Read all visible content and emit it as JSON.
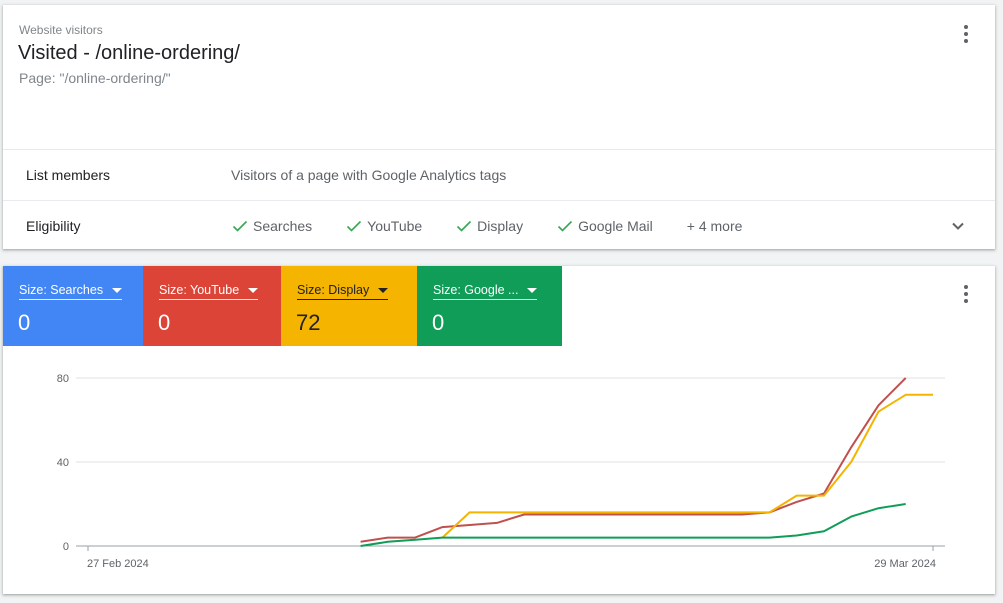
{
  "header": {
    "eyebrow": "Website visitors",
    "title": "Visited - /online-ordering/",
    "subtitle": "Page: \"/online-ordering/\""
  },
  "list_members": {
    "label": "List members",
    "value": "Visitors of a page with Google Analytics tags"
  },
  "eligibility": {
    "label": "Eligibility",
    "items": [
      "Searches",
      "YouTube",
      "Display",
      "Google Mail"
    ],
    "more": "+ 4 more"
  },
  "tiles": [
    {
      "label": "Size: Searches",
      "value": "0",
      "color": "#4285f4"
    },
    {
      "label": "Size: YouTube",
      "value": "0",
      "color": "#db4437"
    },
    {
      "label": "Size: Display",
      "value": "72",
      "color": "#f4b400"
    },
    {
      "label": "Size: Google ...",
      "value": "0",
      "color": "#0f9d58"
    }
  ],
  "colors": {
    "check": "#34a853",
    "red_line": "#c0504d",
    "yellow_line": "#f4b400",
    "green_line": "#0f9d58"
  },
  "icons": {
    "menu": "more-vert-icon",
    "expand": "chevron-down-icon",
    "check": "check-icon",
    "dropdown": "arrow-drop-down-icon"
  },
  "chart_data": {
    "type": "line",
    "x_start_label": "27 Feb 2024",
    "x_end_label": "29 Mar 2024",
    "x": [
      0,
      1,
      2,
      3,
      4,
      5,
      6,
      7,
      8,
      9,
      10,
      11,
      12,
      13,
      14,
      15,
      16,
      17,
      18,
      19,
      20,
      21,
      22,
      23,
      24,
      25,
      26,
      27,
      28,
      29,
      30,
      31
    ],
    "ylim": [
      0,
      80
    ],
    "yticks": [
      0,
      40,
      80
    ],
    "grid": true,
    "series": [
      {
        "color": "#c0504d",
        "values": [
          null,
          null,
          null,
          null,
          null,
          null,
          null,
          null,
          null,
          null,
          2,
          4,
          4,
          9,
          10,
          11,
          15,
          15,
          15,
          15,
          15,
          15,
          15,
          15,
          15,
          16,
          21,
          25,
          47,
          67,
          80,
          null
        ]
      },
      {
        "color": "#f4b400",
        "values": [
          null,
          null,
          null,
          null,
          null,
          null,
          null,
          null,
          null,
          null,
          null,
          null,
          null,
          4,
          16,
          16,
          16,
          16,
          16,
          16,
          16,
          16,
          16,
          16,
          16,
          16,
          24,
          24,
          40,
          64,
          72,
          72
        ]
      },
      {
        "color": "#0f9d58",
        "values": [
          null,
          null,
          null,
          null,
          null,
          null,
          null,
          null,
          null,
          null,
          0,
          2,
          3,
          4,
          4,
          4,
          4,
          4,
          4,
          4,
          4,
          4,
          4,
          4,
          4,
          4,
          5,
          7,
          14,
          18,
          20,
          null
        ]
      }
    ]
  }
}
